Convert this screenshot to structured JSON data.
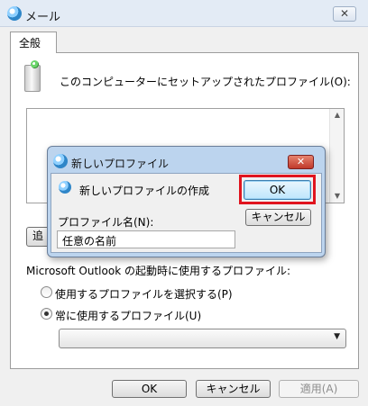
{
  "window": {
    "title": "メール",
    "close_glyph": "✕"
  },
  "tab": {
    "label": "全般"
  },
  "profiles": {
    "label": "このコンピューターにセットアップされたプロファイル(O):",
    "items": []
  },
  "add_button": {
    "label": "追"
  },
  "startup": {
    "label": "Microsoft Outlook の起動時に使用するプロファイル:",
    "options": [
      {
        "label": "使用するプロファイルを選択する(P)",
        "selected": false
      },
      {
        "label": "常に使用するプロファイル(U)",
        "selected": true
      }
    ],
    "dropdown_value": ""
  },
  "footer": {
    "ok": "OK",
    "cancel": "キャンセル",
    "apply": "適用(A)"
  },
  "dialog": {
    "title": "新しいプロファイル",
    "close_glyph": "✕",
    "description": "新しいプロファイルの作成",
    "ok": "OK",
    "cancel": "キャンセル",
    "name_label": "プロファイル名(N):",
    "name_value": "任意の名前"
  },
  "icons": {
    "title": "mail-globe-icon",
    "profile": "profile-cards-icon",
    "dialog": "mail-globe-icon",
    "arrows": {
      "up": "▲",
      "down": "▼"
    }
  },
  "colors": {
    "highlight": "#e0141e",
    "dialog_frame": "#bcd4ee",
    "close_red": "#c0392b"
  }
}
